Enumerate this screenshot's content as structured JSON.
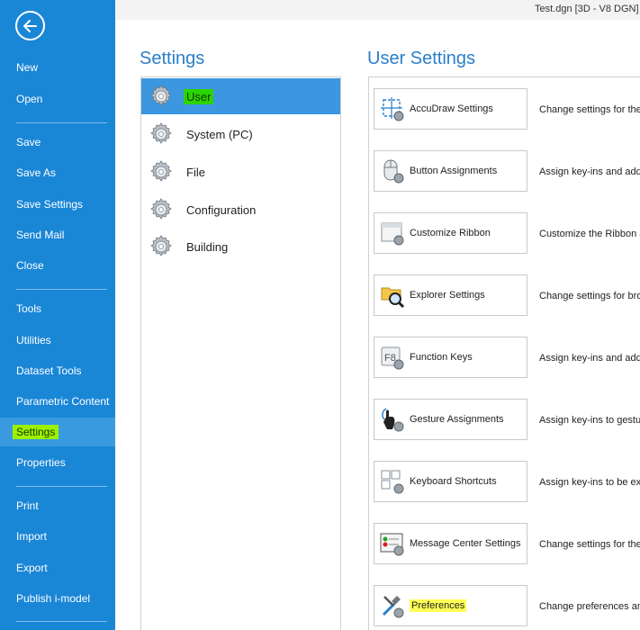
{
  "window": {
    "title": "Test.dgn [3D - V8 DGN] -"
  },
  "nav": {
    "back_icon": "back-arrow-icon",
    "items": [
      {
        "label": "New"
      },
      {
        "label": "Open"
      },
      {
        "label": "Save"
      },
      {
        "label": "Save As"
      },
      {
        "label": "Save Settings"
      },
      {
        "label": "Send Mail"
      },
      {
        "label": "Close"
      },
      {
        "label": "Tools"
      },
      {
        "label": "Utilities"
      },
      {
        "label": "Dataset Tools"
      },
      {
        "label": "Parametric Content"
      },
      {
        "label": "Settings",
        "selected": true
      },
      {
        "label": "Properties"
      },
      {
        "label": "Print"
      },
      {
        "label": "Import"
      },
      {
        "label": "Export"
      },
      {
        "label": "Publish i-model"
      }
    ]
  },
  "settings": {
    "heading": "Settings",
    "categories": [
      {
        "label": "User",
        "selected": true,
        "icon": "gear-icon"
      },
      {
        "label": "System (PC)",
        "icon": "gear-icon"
      },
      {
        "label": "File",
        "icon": "gear-icon"
      },
      {
        "label": "Configuration",
        "icon": "gear-icon"
      },
      {
        "label": "Building",
        "icon": "gear-icon"
      }
    ]
  },
  "user_settings": {
    "heading": "User Settings",
    "items": [
      {
        "label": "AccuDraw Settings",
        "desc": "Change settings for the",
        "icon": "accudraw-icon"
      },
      {
        "label": "Button Assignments",
        "desc": "Assign key-ins and add",
        "icon": "mouse-icon"
      },
      {
        "label": "Customize Ribbon",
        "desc": "Customize the Ribbon a",
        "icon": "ribbon-icon"
      },
      {
        "label": "Explorer Settings",
        "desc": "Change settings for bro",
        "icon": "explorer-icon"
      },
      {
        "label": "Function Keys",
        "desc": "Assign key-ins and add",
        "icon": "function-key-icon"
      },
      {
        "label": "Gesture Assignments",
        "desc": "Assign key-ins to gestu",
        "icon": "gesture-icon"
      },
      {
        "label": "Keyboard Shortcuts",
        "desc": "Assign key-ins to be exe",
        "icon": "keyboard-icon"
      },
      {
        "label": "Message Center Settings",
        "desc": "Change settings for the",
        "icon": "message-center-icon"
      },
      {
        "label": "Preferences",
        "desc": "Change preferences and",
        "icon": "preferences-icon"
      }
    ]
  },
  "colors": {
    "nav_bg": "#1a86d6",
    "accent": "#2a7fc8",
    "selection": "#3c97e0",
    "highlight_green": "#2bd400",
    "highlight_yellow": "#ffff55"
  }
}
